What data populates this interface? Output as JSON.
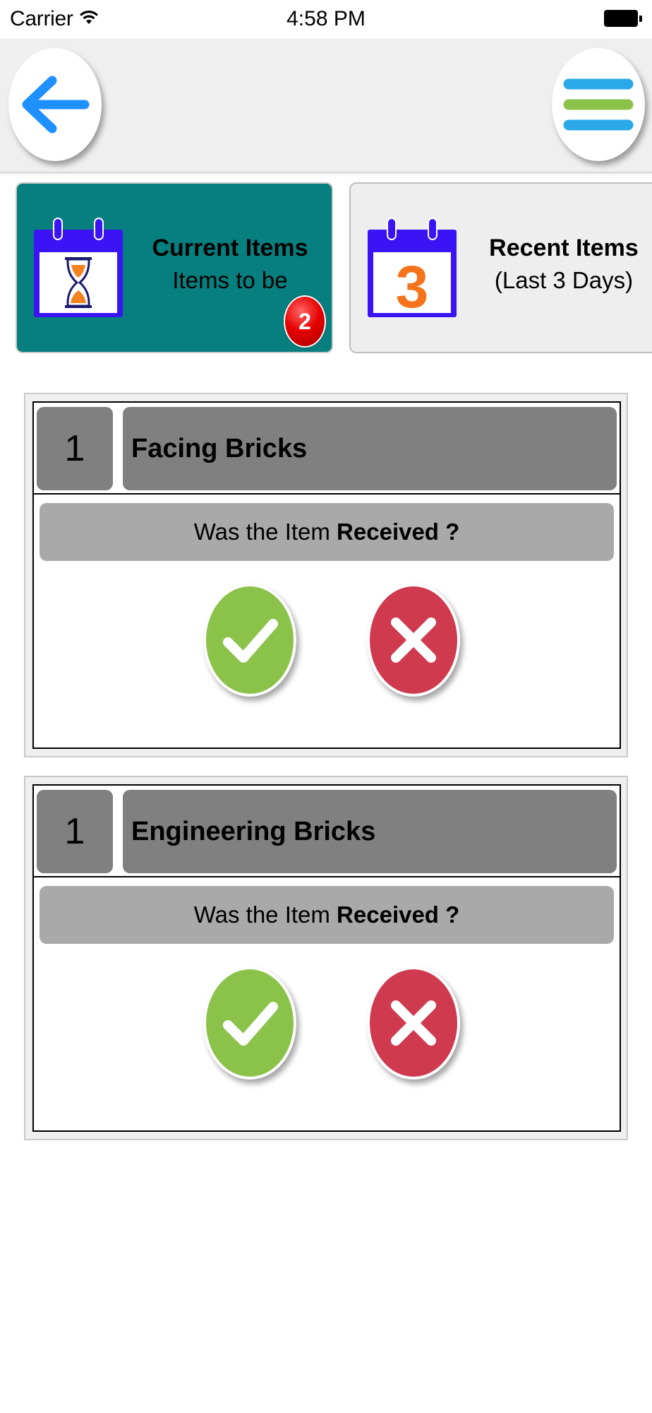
{
  "status_bar": {
    "carrier": "Carrier",
    "time": "4:58 PM"
  },
  "nav": {
    "back_icon": "back-arrow-icon",
    "menu_icon": "hamburger-menu-icon",
    "colors": {
      "back_arrow": "#1e90ff",
      "menu_blue": "#29a9e8",
      "menu_green": "#8bc34a"
    }
  },
  "tiles": {
    "current": {
      "title": "Current Items",
      "subtitle": "Items to be",
      "badge": "2",
      "icon": "calendar-hourglass-icon",
      "color": "#077f7e"
    },
    "recent": {
      "title": "Recent Items",
      "subtitle": "(Last 3 Days)",
      "icon": "calendar-3-icon",
      "calendar_number": "3"
    }
  },
  "items": [
    {
      "qty": "1",
      "name": "Facing Bricks",
      "question_prefix": "Was the Item ",
      "question_bold": "Received ?"
    },
    {
      "qty": "1",
      "name": "Engineering Bricks",
      "question_prefix": "Was the Item ",
      "question_bold": "Received ?"
    }
  ],
  "actions": {
    "accept_icon": "checkmark-icon",
    "reject_icon": "x-mark-icon",
    "accept_color": "#8bc34a",
    "reject_color": "#cf3a4f"
  }
}
